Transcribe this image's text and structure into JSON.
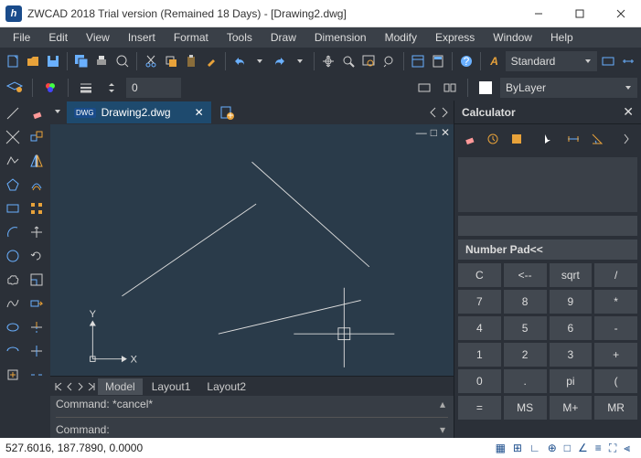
{
  "title": "ZWCAD 2018 Trial version (Remained 18 Days) - [Drawing2.dwg]",
  "logo": "h",
  "menu": [
    "File",
    "Edit",
    "View",
    "Insert",
    "Format",
    "Tools",
    "Draw",
    "Dimension",
    "Modify",
    "Express",
    "Window",
    "Help"
  ],
  "toolbar2": {
    "spin": "0",
    "layer": "ByLayer",
    "style_label": "Standard",
    "style_prefix": "A"
  },
  "doctab": {
    "name": "Drawing2.dwg",
    "icon": "DWG"
  },
  "layout": {
    "tabs": [
      "Model",
      "Layout1",
      "Layout2"
    ],
    "active": 0
  },
  "cmd": {
    "line1": "Command: *cancel*",
    "line2": "Command:"
  },
  "status": {
    "coords": "527.6016, 187.7890, 0.0000"
  },
  "calc": {
    "title": "Calculator",
    "section": "Number Pad<<",
    "keys": [
      "C",
      "<--",
      "sqrt",
      "/",
      "7",
      "8",
      "9",
      "*",
      "4",
      "5",
      "6",
      "-",
      "1",
      "2",
      "3",
      "+",
      "0",
      ".",
      "pi",
      "(",
      "=",
      "MS",
      "M+",
      "MR"
    ]
  },
  "axis": {
    "x": "X",
    "y": "Y"
  }
}
